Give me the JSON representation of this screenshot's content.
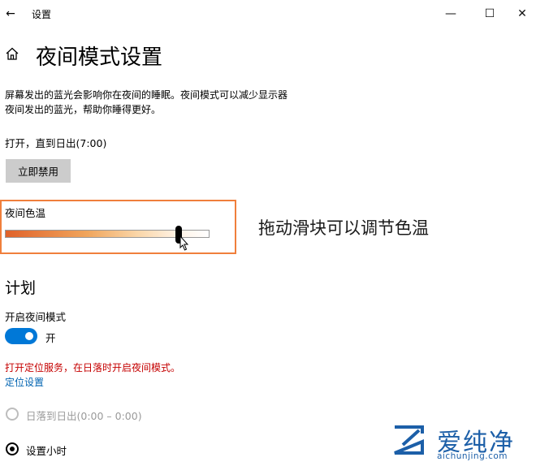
{
  "window": {
    "app_title": "设置",
    "back_glyph": "←",
    "min_glyph": "—",
    "max_glyph": "☐",
    "close_glyph": "✕"
  },
  "page": {
    "title": "夜间模式设置",
    "description_line1": "屏幕发出的蓝光会影响你在夜间的睡眠。夜间模式可以减少显示器",
    "description_line2": "夜间发出的蓝光，帮助你睡得更好。",
    "status": "打开，直到日出(7:00)",
    "disable_button": "立即禁用"
  },
  "color_temp": {
    "label": "夜间色温",
    "level_fraction": 0.85,
    "callout": "拖动滑块可以调节色温"
  },
  "schedule": {
    "section_title": "计划",
    "toggle_label": "开启夜间模式",
    "toggle_state": "开",
    "warning": "打开定位服务，在日落时开启夜间模式。",
    "location_link": "定位设置",
    "option_sunset": "日落到日出(0:00 – 0:00)",
    "option_custom": "设置小时"
  },
  "watermark": {
    "brand": "爱纯净",
    "url": "aichunjing.com"
  },
  "colors": {
    "accent": "#0078d7",
    "highlight_border": "#f07f3c",
    "warning": "#c50000",
    "link": "#0063b1"
  },
  "icons": [
    "back-icon",
    "home-icon",
    "minimize-icon",
    "maximize-icon",
    "close-icon",
    "cursor-icon",
    "brand-logo-icon"
  ]
}
